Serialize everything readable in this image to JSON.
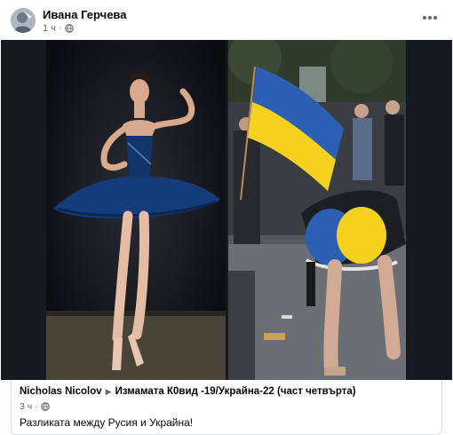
{
  "post": {
    "author": "Ивана Герчева",
    "time": "1 ч",
    "separator": "·",
    "privacy_icon": "globe-icon",
    "more_icon": "more-horizontal-icon"
  },
  "media": {
    "image_left": "ballerina-photo",
    "image_right": "street-crowd-flag-photo"
  },
  "shared_post": {
    "author": "Nicholas Nicolov",
    "arrow_icon": "triangle-right-icon",
    "group": "Измамата К0вид -19/Украйна-22 (част четвърта)",
    "time": "3 ч",
    "separator": "·",
    "privacy_icon": "globe-icon",
    "text": "Разликата между Русия и Украйна!"
  },
  "colors": {
    "primary_text": "#050505",
    "secondary_text": "#65676b",
    "flag_blue": "#2b5fb3",
    "flag_yellow": "#f4d21f",
    "tutu_blue": "#12366a"
  }
}
